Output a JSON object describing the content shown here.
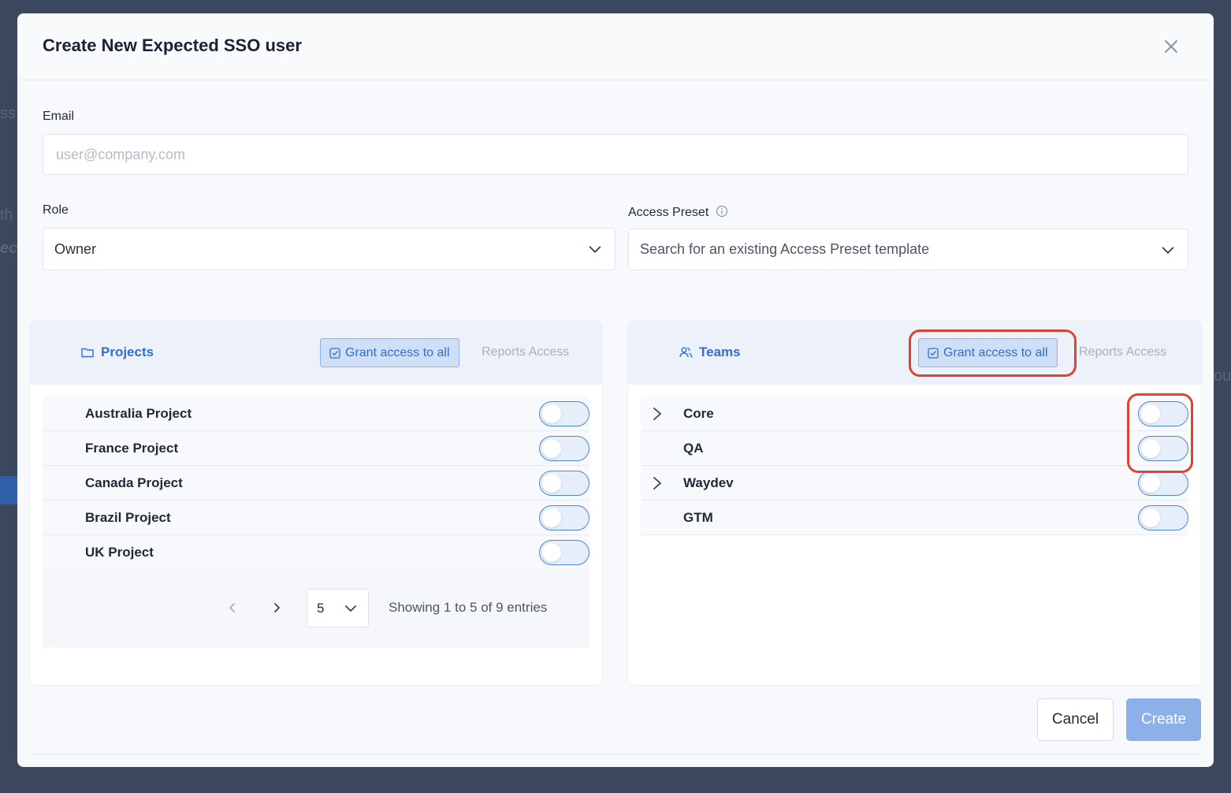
{
  "modal": {
    "title": "Create New Expected SSO user"
  },
  "email": {
    "label": "Email",
    "placeholder": "user@company.com",
    "value": ""
  },
  "role": {
    "label": "Role",
    "selected": "Owner"
  },
  "access_preset": {
    "label": "Access Preset",
    "placeholder": "Search for an existing Access Preset template"
  },
  "projects_panel": {
    "tab_label": "Projects",
    "grant_label": "Grant access to all",
    "reports_label": "Reports Access",
    "items": [
      {
        "name": "Australia Project",
        "enabled": false
      },
      {
        "name": "France Project",
        "enabled": false
      },
      {
        "name": "Canada Project",
        "enabled": false
      },
      {
        "name": "Brazil Project",
        "enabled": false
      },
      {
        "name": "UK Project",
        "enabled": false
      }
    ],
    "pagination": {
      "page_size": "5",
      "entries_text": "Showing 1 to 5 of 9 entries"
    }
  },
  "teams_panel": {
    "tab_label": "Teams",
    "grant_label": "Grant access to all",
    "reports_label": "Reports Access",
    "items": [
      {
        "name": "Core",
        "expandable": true,
        "enabled": false
      },
      {
        "name": "QA",
        "expandable": false,
        "enabled": false
      },
      {
        "name": "Waydev",
        "expandable": true,
        "enabled": false
      },
      {
        "name": "GTM",
        "expandable": false,
        "enabled": false
      }
    ]
  },
  "footer": {
    "cancel_label": "Cancel",
    "create_label": "Create"
  },
  "colors": {
    "accent": "#2f6fd0",
    "highlight": "#e0432f",
    "create_button": "#8db0e8",
    "backdrop": "#3b475d"
  },
  "icons": [
    "close-icon",
    "chevron-down-icon",
    "info-icon",
    "folder-icon",
    "users-icon",
    "checkbox-icon",
    "chevron-right-icon",
    "chevron-left-icon"
  ]
}
